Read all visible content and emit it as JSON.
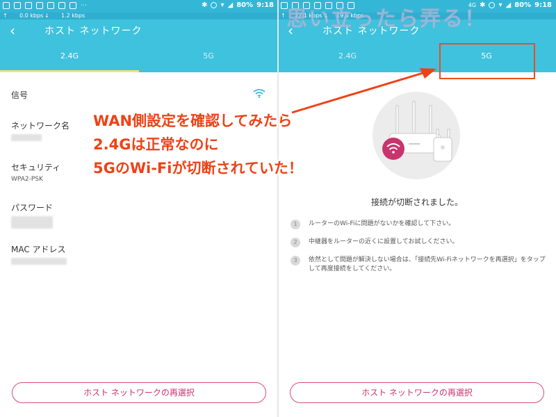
{
  "statusbar": {
    "battery": "80%",
    "time": "9:18",
    "signal_tag": "4G"
  },
  "netbar": {
    "left": {
      "down": "0.0 kbps",
      "up": "1.2 kbps"
    },
    "right": {
      "down": "22.1 kbps",
      "up": "19.5 kbps"
    }
  },
  "left_screen": {
    "back_icon": "chevron-left-icon",
    "title": "ホスト ネットワーク",
    "tabs": [
      {
        "label": "2.4G"
      },
      {
        "label": "5G"
      }
    ],
    "fields": {
      "signal_label": "信号",
      "network_name_label": "ネットワーク名",
      "security_label": "セキュリティ",
      "security_value": "WPA2-PSK",
      "password_label": "パスワード",
      "mac_label": "MAC アドレス"
    },
    "reselect_button": "ホスト ネットワークの再選択"
  },
  "right_screen": {
    "back_icon": "chevron-left-icon",
    "title": "ホスト ネットワーク",
    "tabs": [
      {
        "label": "2.4G"
      },
      {
        "label": "5G"
      }
    ],
    "disconnected_title": "接続が切断されました。",
    "steps": [
      {
        "num": "1",
        "text": "ルーターのWi-Fiに問題がないかを確認して下さい。"
      },
      {
        "num": "2",
        "text": "中継器をルーターの近くに設置してお試しください。"
      },
      {
        "num": "3",
        "text": "依然として問題が解決しない場合は、「接続先Wi-Fiネットワークを再選択」をタップして再度接続をしてください。"
      }
    ],
    "reselect_button": "ホスト ネットワークの再選択"
  },
  "watermark": "思い立ったら弄る！",
  "annotation": {
    "line1": "WAN側設定を確認してみたら",
    "line2": "2.4Gは正常なのに",
    "line3": "5GのWi-Fiが切断されていた！"
  },
  "colors": {
    "header": "#3fc2dd",
    "statusbar": "#34b7d6",
    "tab_indicator": "#f3e37a",
    "button_border": "#d54b7e",
    "annotation": "#ee4216",
    "wifi_signal": "#2fbcd8"
  }
}
